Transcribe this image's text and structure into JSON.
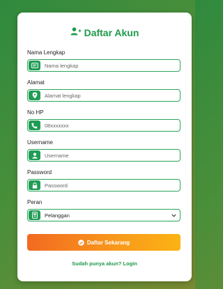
{
  "header": {
    "title": "Daftar Akun",
    "icon": "user-plus-icon"
  },
  "fields": {
    "nama": {
      "label": "Nama Lengkap",
      "placeholder": "Nama lengkap",
      "icon": "id-card-icon"
    },
    "alamat": {
      "label": "Alamat",
      "placeholder": "Alamat lengkap",
      "icon": "map-pin-icon"
    },
    "nohp": {
      "label": "No HP",
      "placeholder": "08xxxxxxx",
      "icon": "phone-icon"
    },
    "username": {
      "label": "Username",
      "placeholder": "Username",
      "icon": "user-icon"
    },
    "password": {
      "label": "Password",
      "placeholder": "Password",
      "icon": "lock-icon"
    },
    "peran": {
      "label": "Peran",
      "value": "Pelanggan",
      "icon": "badge-icon"
    }
  },
  "submit": {
    "label": "Daftar Sekarang",
    "icon": "check-circle-icon"
  },
  "footer": {
    "login_text": "Sudah punya akun? Login"
  },
  "colors": {
    "accent": "#1e9a4a",
    "button_start": "#f26a21",
    "button_end": "#fbb314"
  }
}
